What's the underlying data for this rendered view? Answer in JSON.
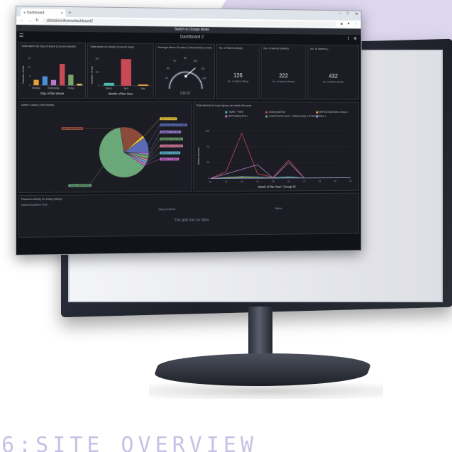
{
  "caption": "6:SITE OVERVIEW",
  "browser": {
    "tab_title": "Dashboard",
    "new_tab": "+",
    "url": "abbdsbsmithview/dashboard2",
    "win_controls": [
      "–",
      "□",
      "✕"
    ]
  },
  "app": {
    "mode_banner": "Switch to Design Mode",
    "dashboard_title": "Dashboard 2"
  },
  "panels": {
    "day_chart": {
      "title": "Total Alarm by Day of week (Current Month)",
      "xlabel": "Day of the Week",
      "ylabel": "Number of Ala"
    },
    "month_chart": {
      "title": "Total Alarm by Month (Current Year)",
      "xlabel": "Month of the Year",
      "ylabel": "Number of Ala"
    },
    "gauge": {
      "title": "Average Alarm Duration (This Month) in mins",
      "value": "136.02"
    },
    "kpi_day": {
      "title": "No. of Alarms (Day)",
      "value": "126",
      "sub": "No. of Alarms (Day)"
    },
    "kpi_week": {
      "title": "No. of alarms (Week)",
      "value": "222",
      "sub": "No. of alarms (Week)"
    },
    "kpi_month": {
      "title": "No. of Alarms (...",
      "value": "432",
      "sub": "No. of Alarms Month"
    },
    "pie": {
      "title": "Alarm Cause (This Month)"
    },
    "line_chart": {
      "title": "Total Alarms by Input group per week this year",
      "xlabel": "Week of the Year / Group ID",
      "ylabel": "Alarm amount"
    },
    "grid": {
      "title": "Planned activity for today (Alarp)",
      "col_time": "Notice/Updated Time",
      "col_content": "Diary Content",
      "col_name": "Name",
      "empty_text": "The grid has no data."
    }
  },
  "chart_data": [
    {
      "type": "bar",
      "title": "Total Alarm by Day of week (Current Month)",
      "xlabel": "Day of the Week",
      "ylabel": "Number of Ala",
      "categories": [
        "Monday",
        "",
        "Wednesday",
        "",
        "Friday",
        ""
      ],
      "values": [
        3,
        5,
        3,
        12,
        6,
        1
      ],
      "colors": [
        "#e6a33a",
        "#4a8fd6",
        "#b57bc9",
        "#c94a55",
        "#7aa66a",
        "#d9c24a"
      ],
      "ylim": [
        0,
        15
      ],
      "yticks": [
        "0",
        "5",
        "10",
        "15"
      ]
    },
    {
      "type": "bar",
      "title": "Total Alarm by Month (Current Year)",
      "xlabel": "Month of the Year",
      "ylabel": "Number of Ala",
      "categories": [
        "March",
        "April",
        "May"
      ],
      "values": [
        20,
        200,
        10
      ],
      "colors": [
        "#4ac3b1",
        "#c94a55",
        "#e6a33a"
      ],
      "ylim": [
        0,
        200
      ],
      "yticks": [
        "0",
        "100",
        "200"
      ]
    },
    {
      "type": "pie",
      "title": "Alarm Cause (This Month)",
      "labels": [
        "Fault",
        "Input",
        "Nothing Seen",
        "Mistaken",
        "Engineers",
        "Contractors",
        "Weather",
        "Wildlife",
        "Testing"
      ],
      "slice_texts": [
        "Fault: 1.83 (16.83%)",
        "Input: 9 (2.07%)",
        "Nothing Seen: 41 (10.29%)",
        "Mistaken: 7 (1.76%)",
        "Engineers: 12 (2.76%)",
        "Contractors: 7 (1.61%)",
        "Weather: 7 (1.61%)",
        "Wildlife: 8 (1.84%)",
        "Testing: 288 (66.89%)"
      ],
      "values": [
        16.83,
        2.07,
        10.29,
        1.76,
        2.76,
        1.61,
        1.61,
        1.84,
        66.89
      ],
      "colors": [
        "#8c4a3a",
        "#e6c23a",
        "#5a6ab5",
        "#9a7ad0",
        "#6f9f6a",
        "#d07a9a",
        "#5ab0c8",
        "#c96ad0",
        "#6aa87a"
      ]
    },
    {
      "type": "line",
      "title": "Total Alarms by Input group per week this year",
      "xlabel": "Week of the Year / Group ID",
      "ylabel": "Alarm amount",
      "x": [
        11,
        12,
        13,
        14,
        15,
        16,
        17,
        18,
        19,
        20
      ],
      "ylim": [
        0,
        120
      ],
      "yticks": [
        "0",
        "35",
        "70",
        "105"
      ],
      "series": [
        {
          "name": "Jupiter - Panel",
          "color": "#4fb3c9",
          "values": [
            0,
            2,
            4,
            3,
            1,
            3,
            0,
            0,
            0,
            0
          ]
        },
        {
          "name": "Acacia grad Box",
          "color": "#c94a55",
          "values": [
            0,
            15,
            100,
            10,
            2,
            40,
            0,
            0,
            0,
            0
          ]
        },
        {
          "name": "BHP ACCUM Demo Group 1",
          "color": "#e6a33a",
          "values": [
            0,
            1,
            2,
            1,
            0,
            1,
            0,
            0,
            0,
            0
          ]
        },
        {
          "name": "BHP Galaxy Area 1",
          "color": "#b57bc9",
          "values": [
            0,
            10,
            20,
            30,
            0,
            35,
            0,
            0,
            0,
            0
          ]
        },
        {
          "name": "Cortech Demo Room - Galaxy Group 1 GC10/GS7",
          "color": "#7aa66a",
          "values": [
            0,
            0,
            1,
            0,
            0,
            1,
            0,
            0,
            0,
            0
          ]
        },
        {
          "name": "New 1",
          "color": "#8b8fd6",
          "values": [
            0,
            0,
            0,
            0,
            0,
            0,
            0,
            0,
            0,
            0
          ]
        }
      ]
    }
  ]
}
